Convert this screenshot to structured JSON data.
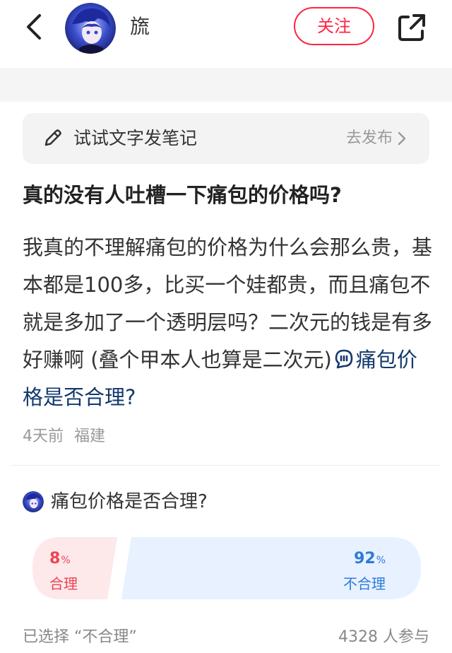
{
  "header": {
    "author_name": "旒",
    "follow_label": "关注",
    "icons": [
      "back-icon",
      "avatar",
      "share-icon"
    ]
  },
  "note_prompt": {
    "text": "试试文字发笔记",
    "action_label": "去发布",
    "icon": "pencil-icon"
  },
  "post": {
    "title": "真的没有人吐槽一下痛包的价格吗?",
    "body": "我真的不理解痛包的价格为什么会那么贵，基本都是100多，比买一个娃都贵，而且痛包不就是多加了一个透明层吗？二次元的钱是有多好赚啊 (叠个甲本人也算是二次元)",
    "topic": "痛包价格是否合理?",
    "time": "4天前",
    "location": "福建"
  },
  "poll": {
    "question": "痛包价格是否合理?",
    "options": [
      {
        "label": "合理",
        "percent": "8",
        "percent_sign": "%",
        "share": 0.08,
        "color": "#ee4455"
      },
      {
        "label": "不合理",
        "percent": "92",
        "percent_sign": "%",
        "share": 0.92,
        "color": "#2f7ad9"
      }
    ],
    "selected_text": "已选择 “不合理”",
    "participants": "4328 人参与"
  },
  "colors": {
    "accent": "#ff2442",
    "topic_link": "#13386c",
    "poll_agree_bg": "#fde8ea",
    "poll_disagree_bg": "#e7f1ff"
  }
}
